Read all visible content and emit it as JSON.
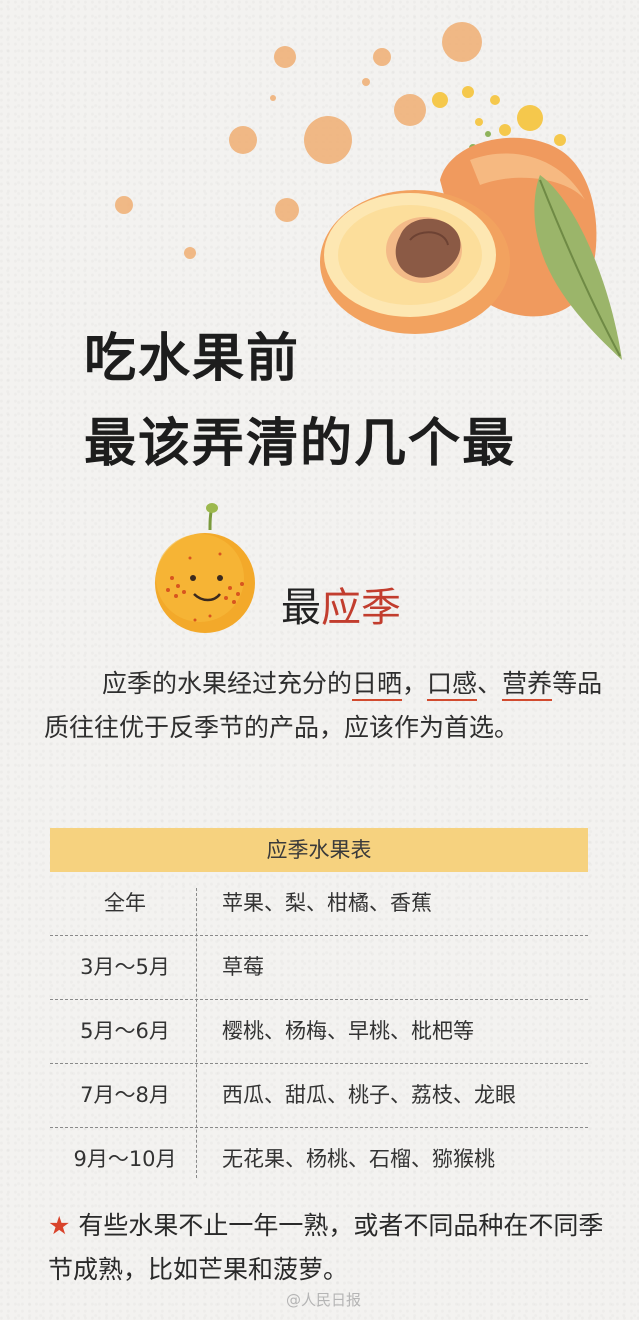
{
  "title": {
    "line1": "吃水果前",
    "line2": "最该弄清的几个最"
  },
  "section": {
    "prefix": "最",
    "accent": "应季"
  },
  "paragraph": {
    "p1": "应季的水果经过充分的",
    "h1": "日晒",
    "p2": "，",
    "h2": "口感",
    "p3": "、",
    "h3": "营养",
    "p4": "等品质往往优于反季节的产品，应该作为首选。"
  },
  "table": {
    "header": "应季水果表",
    "rows": [
      {
        "period": "全年",
        "fruits": "苹果、梨、柑橘、香蕉"
      },
      {
        "period": "3月～5月",
        "fruits": "草莓"
      },
      {
        "period": "5月～6月",
        "fruits": "樱桃、杨梅、早桃、枇杷等"
      },
      {
        "period": "7月～8月",
        "fruits": "西瓜、甜瓜、桃子、荔枝、龙眼"
      },
      {
        "period": "9月～10月",
        "fruits": "无花果、杨桃、石榴、猕猴桃"
      }
    ]
  },
  "note": {
    "star": "★",
    "text": "有些水果不止一年一熟，或者不同品种在不同季节成熟，比如芒果和菠萝。"
  },
  "watermark": "@人民日报",
  "colors": {
    "accent_red": "#c23d2e",
    "table_header": "#f6d27f",
    "star": "#d9432b"
  },
  "icons": [
    "peach-illustration",
    "orange-smiley-icon"
  ]
}
